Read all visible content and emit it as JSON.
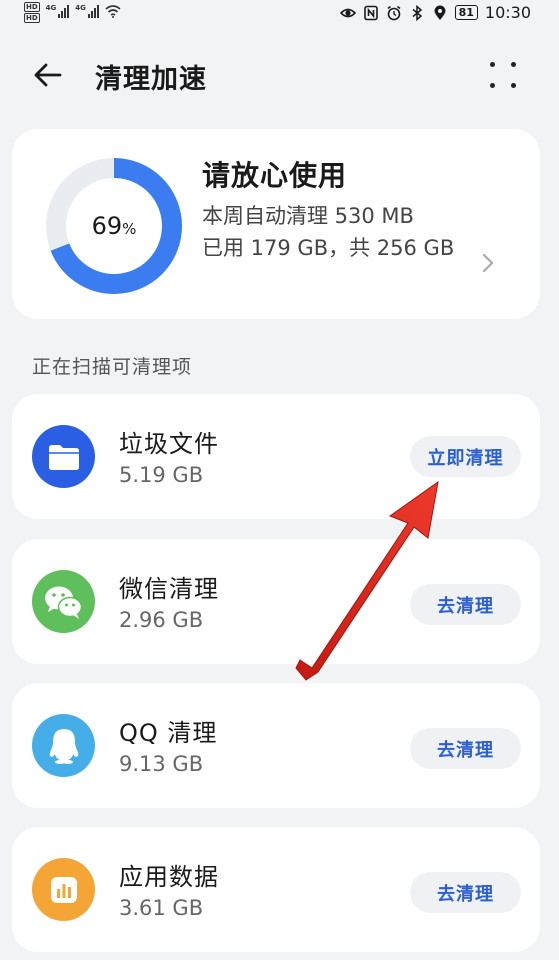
{
  "status_bar": {
    "sim1": "HD",
    "sim2": "HD",
    "net1": "4G",
    "net2": "4G",
    "battery": "81",
    "time": "10:30"
  },
  "header": {
    "title": "清理加速",
    "back_icon": "arrow-left-icon",
    "more_icon": "more-dots-icon"
  },
  "summary": {
    "percent": "69",
    "percent_sign": "%",
    "percent_value": 69,
    "title": "请放心使用",
    "weekly_text": "本周自动清理 530 MB",
    "usage_text": "已用 179 GB，共 256 GB"
  },
  "section_label": "正在扫描可清理项",
  "items": [
    {
      "title": "垃圾文件",
      "size": "5.19 GB",
      "action": "立即清理",
      "icon": "folder-icon",
      "color": "#2b5fe3"
    },
    {
      "title": "微信清理",
      "size": "2.96 GB",
      "action": "去清理",
      "icon": "wechat-icon",
      "color": "#5fbf5c"
    },
    {
      "title": "QQ 清理",
      "size": "9.13 GB",
      "action": "去清理",
      "icon": "qq-penguin-icon",
      "color": "#45aee8"
    },
    {
      "title": "应用数据",
      "size": "3.61 GB",
      "action": "去清理",
      "icon": "app-data-chart-icon",
      "color": "#f4a536"
    }
  ],
  "colors": {
    "accent": "#2a5ed6",
    "ring": "#3b7cf0",
    "ring_track": "#e9ecf1",
    "annotation_arrow": "#e0251b"
  }
}
